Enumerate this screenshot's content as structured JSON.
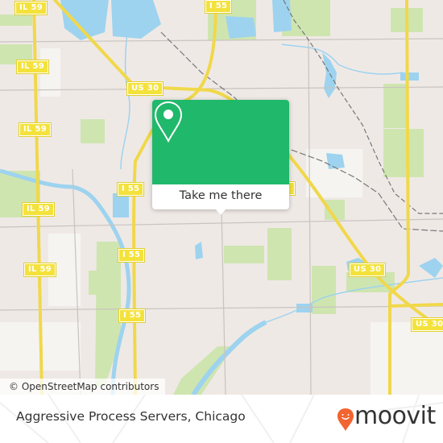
{
  "map": {
    "attribution": "© OpenStreetMap contributors",
    "colors": {
      "land": "#efe9e6",
      "park": "#cfe5b0",
      "water": "#9dd3ef",
      "road_major": "#f5df56",
      "road_minor": "#c9c3bf",
      "rail": "#777777"
    },
    "shields": [
      {
        "label": "IL 59",
        "name": "shield-il59-1"
      },
      {
        "label": "IL 59",
        "name": "shield-il59-2"
      },
      {
        "label": "IL 59",
        "name": "shield-il59-3"
      },
      {
        "label": "IL 59",
        "name": "shield-il59-4"
      },
      {
        "label": "IL 59",
        "name": "shield-il59-5"
      },
      {
        "label": "I 55",
        "name": "shield-i55-1"
      },
      {
        "label": "I 55",
        "name": "shield-i55-2"
      },
      {
        "label": "I 55",
        "name": "shield-i55-3"
      },
      {
        "label": "I 55",
        "name": "shield-i55-4"
      },
      {
        "label": "I 55",
        "name": "shield-i55-5"
      },
      {
        "label": "US 30",
        "name": "shield-us30-1"
      },
      {
        "label": "US 30",
        "name": "shield-us30-2"
      },
      {
        "label": "US 30",
        "name": "shield-us30-3"
      }
    ]
  },
  "popup": {
    "icon": "map-pin-icon",
    "button_label": "Take me there",
    "accent": "#20b86a"
  },
  "footer": {
    "place_name": "Aggressive Process Servers, Chicago",
    "brand": "moovit",
    "brand_color": "#f26430"
  }
}
